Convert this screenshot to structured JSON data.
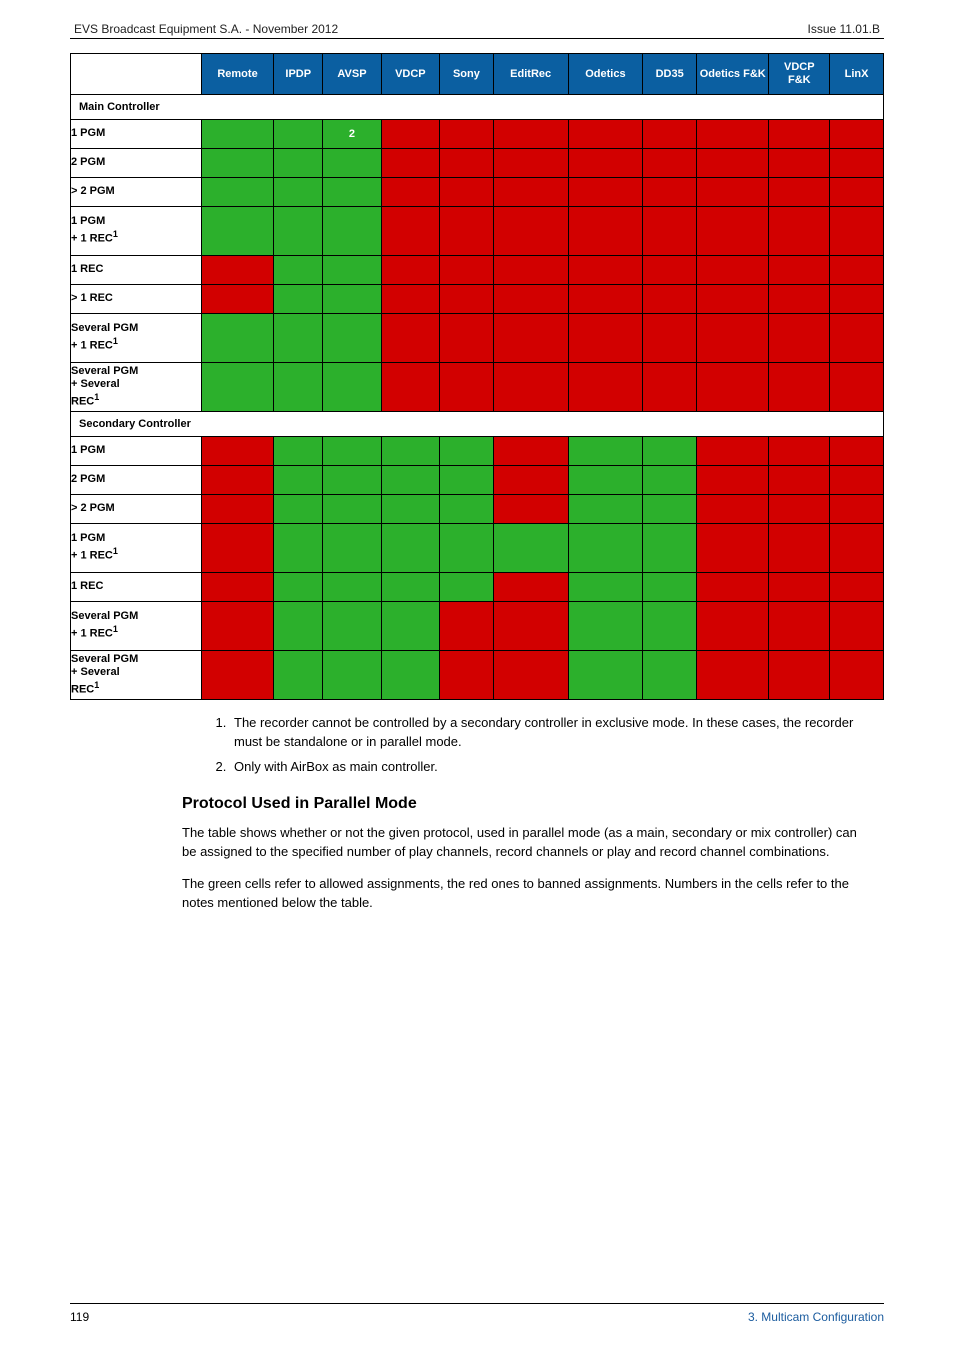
{
  "top": {
    "left": "EVS Broadcast Equipment S.A. - November 2012",
    "right": "Issue 11.01.B"
  },
  "table": {
    "headers": [
      "",
      "Remote",
      "IPDP",
      "AVSP",
      "VDCP",
      "Sony",
      "EditRec",
      "Odetics",
      "DD35",
      "Odetics F&K",
      "VDCP F&K",
      "LinX"
    ],
    "sections": [
      {
        "title": "Main Controller",
        "rows": [
          {
            "label": "1 PGM",
            "cells": [
              "g",
              "g",
              "g",
              "r",
              "r",
              "r",
              "r",
              "r",
              "r",
              "r",
              "r"
            ],
            "note_col": 2,
            "note_text": "2"
          },
          {
            "label": "2 PGM",
            "cells": [
              "g",
              "g",
              "g",
              "r",
              "r",
              "r",
              "r",
              "r",
              "r",
              "r",
              "r"
            ]
          },
          {
            "label": "> 2 PGM",
            "cells": [
              "g",
              "g",
              "g",
              "r",
              "r",
              "r",
              "r",
              "r",
              "r",
              "r",
              "r"
            ]
          },
          {
            "label": "1 PGM\n+ 1 REC",
            "sup": "1",
            "tall": true,
            "cells": [
              "g",
              "g",
              "g",
              "r",
              "r",
              "r",
              "r",
              "r",
              "r",
              "r",
              "r"
            ]
          },
          {
            "label": "1 REC",
            "cells": [
              "r",
              "g",
              "g",
              "r",
              "r",
              "r",
              "r",
              "r",
              "r",
              "r",
              "r"
            ]
          },
          {
            "label": "> 1 REC",
            "cells": [
              "r",
              "g",
              "g",
              "r",
              "r",
              "r",
              "r",
              "r",
              "r",
              "r",
              "r"
            ]
          },
          {
            "label": "Several PGM\n+ 1 REC",
            "sup": "1",
            "tall": true,
            "cells": [
              "g",
              "g",
              "g",
              "r",
              "r",
              "r",
              "r",
              "r",
              "r",
              "r",
              "r"
            ]
          },
          {
            "label": "Several PGM\n+ Several\nREC",
            "sup": "1",
            "tall": true,
            "cells": [
              "g",
              "g",
              "g",
              "r",
              "r",
              "r",
              "r",
              "r",
              "r",
              "r",
              "r"
            ]
          }
        ]
      },
      {
        "title": "Secondary Controller",
        "rows": [
          {
            "label": "1 PGM",
            "cells": [
              "r",
              "g",
              "g",
              "g",
              "g",
              "r",
              "g",
              "g",
              "r",
              "r",
              "r"
            ]
          },
          {
            "label": "2 PGM",
            "cells": [
              "r",
              "g",
              "g",
              "g",
              "g",
              "r",
              "g",
              "g",
              "r",
              "r",
              "r"
            ]
          },
          {
            "label": "> 2 PGM",
            "cells": [
              "r",
              "g",
              "g",
              "g",
              "g",
              "r",
              "g",
              "g",
              "r",
              "r",
              "r"
            ]
          },
          {
            "label": "1 PGM\n+ 1 REC",
            "sup": "1",
            "tall": true,
            "cells": [
              "r",
              "g",
              "g",
              "g",
              "g",
              "g",
              "g",
              "g",
              "r",
              "r",
              "r"
            ]
          },
          {
            "label": "1 REC",
            "cells": [
              "r",
              "g",
              "g",
              "g",
              "g",
              "r",
              "g",
              "g",
              "r",
              "r",
              "r"
            ]
          },
          {
            "label": "Several PGM\n+ 1 REC",
            "sup": "1",
            "tall": true,
            "cells": [
              "r",
              "g",
              "g",
              "g",
              "r",
              "r",
              "g",
              "g",
              "r",
              "r",
              "r"
            ]
          },
          {
            "label": "Several PGM\n+ Several\nREC",
            "sup": "1",
            "tall": true,
            "cells": [
              "r",
              "g",
              "g",
              "g",
              "r",
              "r",
              "g",
              "g",
              "r",
              "r",
              "r"
            ]
          }
        ]
      }
    ]
  },
  "notes": [
    "The recorder cannot be controlled by a secondary controller in exclusive mode. In these cases, the recorder must be standalone or in parallel mode.",
    "Only with AirBox as main controller."
  ],
  "subhead": "Protocol Used in Parallel Mode",
  "paras": [
    "The table shows whether or not the given protocol, used in parallel mode (as a main, secondary or mix controller) can be assigned to the specified number of play channels, record channels or play and record channel combinations.",
    "The green cells refer to allowed assignments, the red ones to banned assignments. Numbers in the cells refer to the notes mentioned below the table."
  ],
  "footer": {
    "page": "119",
    "section": "3. Multicam Configuration"
  }
}
